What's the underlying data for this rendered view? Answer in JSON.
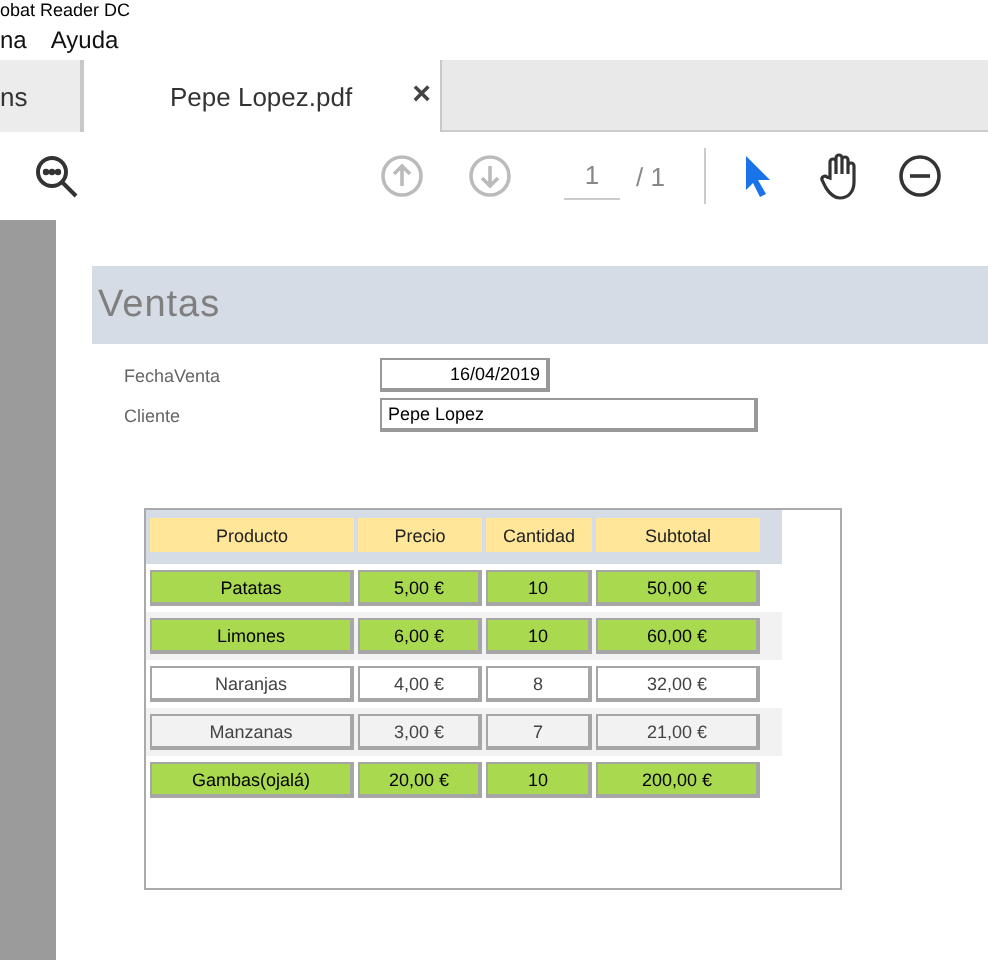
{
  "window": {
    "title": "obat Reader DC"
  },
  "menu": [
    "na",
    "Ayuda"
  ],
  "tabs": [
    {
      "label": "ns",
      "selected": false
    },
    {
      "label": "Pepe Lopez.pdf",
      "selected": true,
      "close": "×"
    }
  ],
  "toolbar": {
    "page": "1",
    "total": "/ 1"
  },
  "document": {
    "heading": "Ventas",
    "fields": [
      {
        "label": "FechaVenta",
        "value": "16/04/2019",
        "kind": "date"
      },
      {
        "label": "Cliente",
        "value": "Pepe Lopez",
        "kind": "text"
      }
    ],
    "table": {
      "columns": [
        "Producto",
        "Precio",
        "Cantidad",
        "Subtotal"
      ],
      "rows": [
        {
          "cells": [
            "Patatas",
            "5,00 €",
            "10",
            "50,00 €"
          ],
          "highlighted": true,
          "striped": false
        },
        {
          "cells": [
            "Limones",
            "6,00 €",
            "10",
            "60,00 €"
          ],
          "highlighted": true,
          "striped": true
        },
        {
          "cells": [
            "Naranjas",
            "4,00 €",
            "8",
            "32,00 €"
          ],
          "highlighted": false,
          "striped": false
        },
        {
          "cells": [
            "Manzanas",
            "3,00 €",
            "7",
            "21,00 €"
          ],
          "highlighted": false,
          "striped": true
        },
        {
          "cells": [
            "Gambas(ojalá)",
            "20,00 €",
            "10",
            "200,00 €"
          ],
          "highlighted": true,
          "striped": false
        }
      ]
    }
  }
}
